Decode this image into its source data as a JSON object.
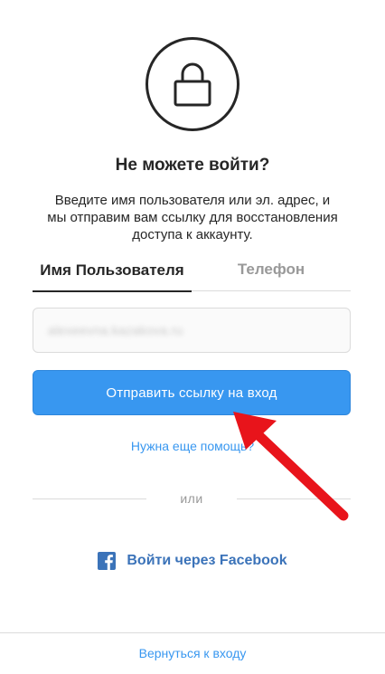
{
  "header": {
    "icon": "lock-icon",
    "title": "Не можете войти?",
    "description": "Введите имя пользователя или эл. адрес, и мы отправим вам ссылку для восстановления доступа к аккаунту."
  },
  "tabs": {
    "username": "Имя Пользователя",
    "phone": "Телефон",
    "active": "username"
  },
  "form": {
    "username_value": "alexeevna.kazakova.ru",
    "send_button_label": "Отправить ссылку на вход",
    "help_link": "Нужна еще помощь?"
  },
  "divider": {
    "label": "или"
  },
  "facebook": {
    "icon": "facebook-icon",
    "label": "Войти через Facebook"
  },
  "footer": {
    "back_link": "Вернуться к входу"
  },
  "colors": {
    "primary": "#3897f0",
    "text": "#262626",
    "muted": "#999999",
    "border": "#dbdbdb",
    "facebook": "#3b73b9",
    "annotation_arrow": "#e8141b"
  }
}
